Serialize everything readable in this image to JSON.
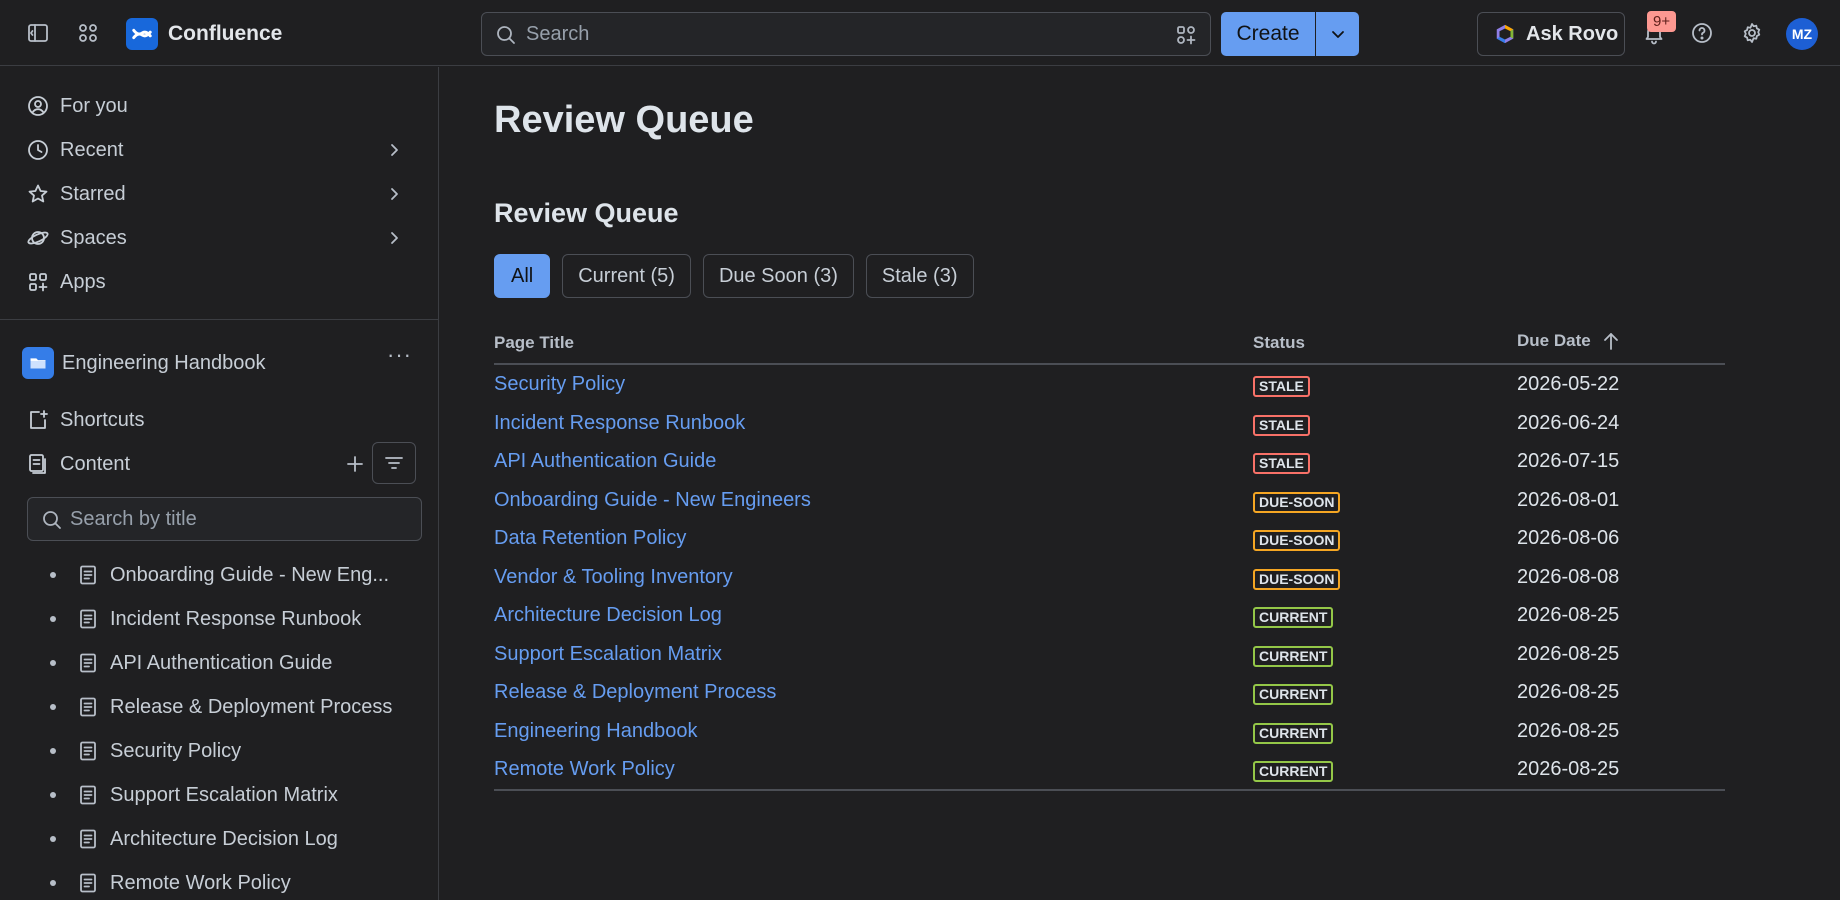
{
  "topbar": {
    "app_name": "Confluence",
    "search_placeholder": "Search",
    "create_label": "Create",
    "rovo_label": "Ask Rovo",
    "notification_count": "9+",
    "avatar_initials": "MZ",
    "icons": [
      "sidebar-toggle-icon",
      "app-switcher-icon",
      "search-icon",
      "chevron-down-icon",
      "bell-icon",
      "help-icon",
      "gear-icon"
    ]
  },
  "sidebar": {
    "nav": [
      {
        "label": "For you",
        "icon": "person-icon",
        "has_chevron": false
      },
      {
        "label": "Recent",
        "icon": "clock-icon",
        "has_chevron": true
      },
      {
        "label": "Starred",
        "icon": "star-icon",
        "has_chevron": true
      },
      {
        "label": "Spaces",
        "icon": "planet-icon",
        "has_chevron": true
      },
      {
        "label": "Apps",
        "icon": "apps-icon",
        "has_chevron": false
      }
    ],
    "space_name": "Engineering Handbook",
    "shortcuts_label": "Shortcuts",
    "content_label": "Content",
    "title_search_placeholder": "Search by title",
    "tree": [
      "Onboarding Guide - New Eng...",
      "Incident Response Runbook",
      "API Authentication Guide",
      "Release & Deployment Process",
      "Security Policy",
      "Support Escalation Matrix",
      "Architecture Decision Log",
      "Remote Work Policy"
    ]
  },
  "main": {
    "page_title": "Review Queue",
    "section_title": "Review Queue",
    "tabs": [
      {
        "label": "All",
        "active": true
      },
      {
        "label": "Current (5)",
        "active": false
      },
      {
        "label": "Due Soon (3)",
        "active": false
      },
      {
        "label": "Stale (3)",
        "active": false
      }
    ],
    "table": {
      "headers": {
        "title": "Page Title",
        "status": "Status",
        "due_date": "Due Date"
      },
      "rows": [
        {
          "title": "Security Policy",
          "status": "STALE",
          "due_date": "2026-05-22"
        },
        {
          "title": "Incident Response Runbook",
          "status": "STALE",
          "due_date": "2026-06-24"
        },
        {
          "title": "API Authentication Guide",
          "status": "STALE",
          "due_date": "2026-07-15"
        },
        {
          "title": "Onboarding Guide - New Engineers",
          "status": "DUE-SOON",
          "due_date": "2026-08-01"
        },
        {
          "title": "Data Retention Policy",
          "status": "DUE-SOON",
          "due_date": "2026-08-06"
        },
        {
          "title": "Vendor & Tooling Inventory",
          "status": "DUE-SOON",
          "due_date": "2026-08-08"
        },
        {
          "title": "Architecture Decision Log",
          "status": "CURRENT",
          "due_date": "2026-08-25"
        },
        {
          "title": "Support Escalation Matrix",
          "status": "CURRENT",
          "due_date": "2026-08-25"
        },
        {
          "title": "Release & Deployment Process",
          "status": "CURRENT",
          "due_date": "2026-08-25"
        },
        {
          "title": "Engineering Handbook",
          "status": "CURRENT",
          "due_date": "2026-08-25"
        },
        {
          "title": "Remote Work Policy",
          "status": "CURRENT",
          "due_date": "2026-08-25"
        }
      ]
    }
  },
  "colors": {
    "background": "#1f1f21",
    "accent": "#669df1",
    "stale": "#f87168",
    "due_soon": "#f5a623",
    "current": "#94c748"
  }
}
